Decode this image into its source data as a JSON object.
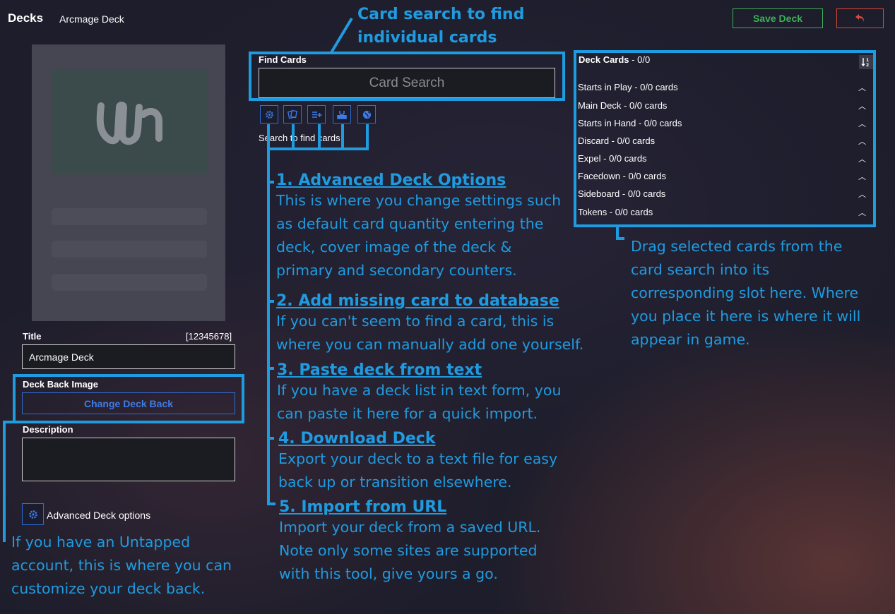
{
  "header": {
    "title": "Decks",
    "subtitle": "Arcmage Deck",
    "save_label": "Save Deck",
    "back_icon": "undo-arrow-icon"
  },
  "colors": {
    "accent": "#1f9be0",
    "save": "#3cb05a",
    "back": "#d84a3a",
    "button_blue": "#2f6cd6"
  },
  "left": {
    "title_label": "Title",
    "title_count": "[12345678]",
    "title_value": "Arcmage Deck",
    "deck_back_label": "Deck Back Image",
    "change_back_label": "Change Deck Back",
    "description_label": "Description",
    "advanced_label": "Advanced Deck options"
  },
  "search": {
    "label": "Find Cards",
    "placeholder": "Card Search",
    "hint": "Search to find cards",
    "icons": [
      "gear-icon",
      "cards-icon",
      "list-add-icon",
      "download-icon",
      "globe-icon"
    ]
  },
  "deck": {
    "title": "Deck Cards",
    "count": " - 0/0",
    "sort_icon": "sort-icon",
    "sections": [
      "Starts in Play - 0/0 cards",
      "Main Deck - 0/0 cards",
      "Starts in Hand - 0/0 cards",
      "Discard - 0/0 cards",
      "Expel - 0/0 cards",
      "Facedown - 0/0 cards",
      "Sideboard - 0/0 cards",
      "Tokens - 0/0 cards"
    ]
  },
  "annotations": {
    "search_top": [
      "Card search to find",
      "individual cards"
    ],
    "items": [
      {
        "heading": "1. Advanced Deck Options",
        "lines": [
          "This is where you change settings such",
          "as default card quantity entering the",
          "deck, cover image of the deck &",
          "primary and secondary counters."
        ]
      },
      {
        "heading": "2. Add missing card to database",
        "lines": [
          "If you can't seem to find a card, this is",
          "where you can manually add one yourself."
        ]
      },
      {
        "heading": "3. Paste deck from text",
        "lines": [
          "If you have a deck list in text form, you",
          "can paste it here for a quick import."
        ]
      },
      {
        "heading": "4. Download Deck",
        "lines": [
          "Export your deck to a text file for easy",
          "back up or transition elsewhere."
        ]
      },
      {
        "heading": "5. Import from URL",
        "lines": [
          "Import your deck from a saved URL.",
          "Note only some sites are supported",
          "with this tool, give yours a go."
        ]
      }
    ],
    "deck_note": [
      "Drag selected cards from the",
      "card search into its",
      "corresponding slot here. Where",
      "you place it here is where it will",
      "appear in game."
    ],
    "back_note": [
      "If you have an Untapped",
      "account, this is where you can",
      "customize your deck back."
    ]
  }
}
